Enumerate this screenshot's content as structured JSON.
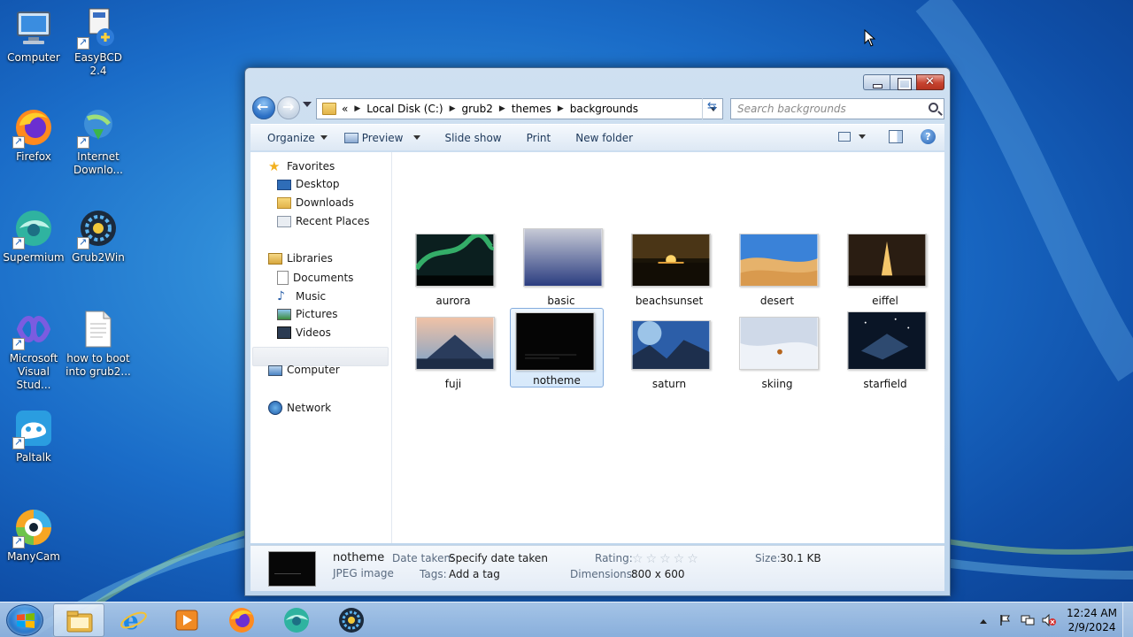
{
  "desktop": {
    "icons": [
      {
        "label_1": "Computer",
        "label_2": ""
      },
      {
        "label_1": "EasyBCD 2.4",
        "label_2": ""
      },
      {
        "label_1": "Firefox",
        "label_2": ""
      },
      {
        "label_1": "Internet",
        "label_2": "Downlo..."
      },
      {
        "label_1": "Supermium",
        "label_2": ""
      },
      {
        "label_1": "Grub2Win",
        "label_2": ""
      },
      {
        "label_1": "Microsoft",
        "label_2": "Visual Stud..."
      },
      {
        "label_1": "how to boot",
        "label_2": "into grub2..."
      },
      {
        "label_1": "Paltalk",
        "label_2": ""
      },
      {
        "label_1": "ManyCam",
        "label_2": ""
      }
    ]
  },
  "explorer": {
    "breadcrumb": {
      "overflow": "«",
      "items": [
        "Local Disk (C:)",
        "grub2",
        "themes",
        "backgrounds"
      ]
    },
    "search": {
      "placeholder": "Search backgrounds"
    },
    "commands": {
      "organize": "Organize",
      "preview": "Preview",
      "slideshow": "Slide show",
      "print": "Print",
      "new_folder": "New folder"
    },
    "nav": {
      "favorites": "Favorites",
      "desktop": "Desktop",
      "downloads": "Downloads",
      "recent": "Recent Places",
      "libraries": "Libraries",
      "documents": "Documents",
      "music": "Music",
      "pictures": "Pictures",
      "videos": "Videos",
      "computer": "Computer",
      "network": "Network"
    },
    "files": [
      {
        "name": "aurora"
      },
      {
        "name": "basic"
      },
      {
        "name": "beachsunset"
      },
      {
        "name": "desert"
      },
      {
        "name": "eiffel"
      },
      {
        "name": "fuji"
      },
      {
        "name": "notheme",
        "selected": true
      },
      {
        "name": "saturn"
      },
      {
        "name": "skiing"
      },
      {
        "name": "starfield"
      }
    ],
    "details": {
      "name": "notheme",
      "type": "JPEG image",
      "date_label": "Date taken:",
      "date_value": "Specify date taken",
      "tags_label": "Tags:",
      "tags_value": "Add a tag",
      "rating_label": "Rating:",
      "rating_stars": "☆☆☆☆☆",
      "rating_value": 0,
      "dims_label": "Dimensions:",
      "dims_value": "800 x 600",
      "size_label": "Size:",
      "size_value": "30.1 KB"
    }
  },
  "taskbar": {
    "time": "12:24 AM",
    "date": "2/9/2024"
  },
  "colors": {
    "desktop_blue": "#1a6cc8",
    "selection": "#d7e9fb",
    "close_red": "#c7432f"
  }
}
